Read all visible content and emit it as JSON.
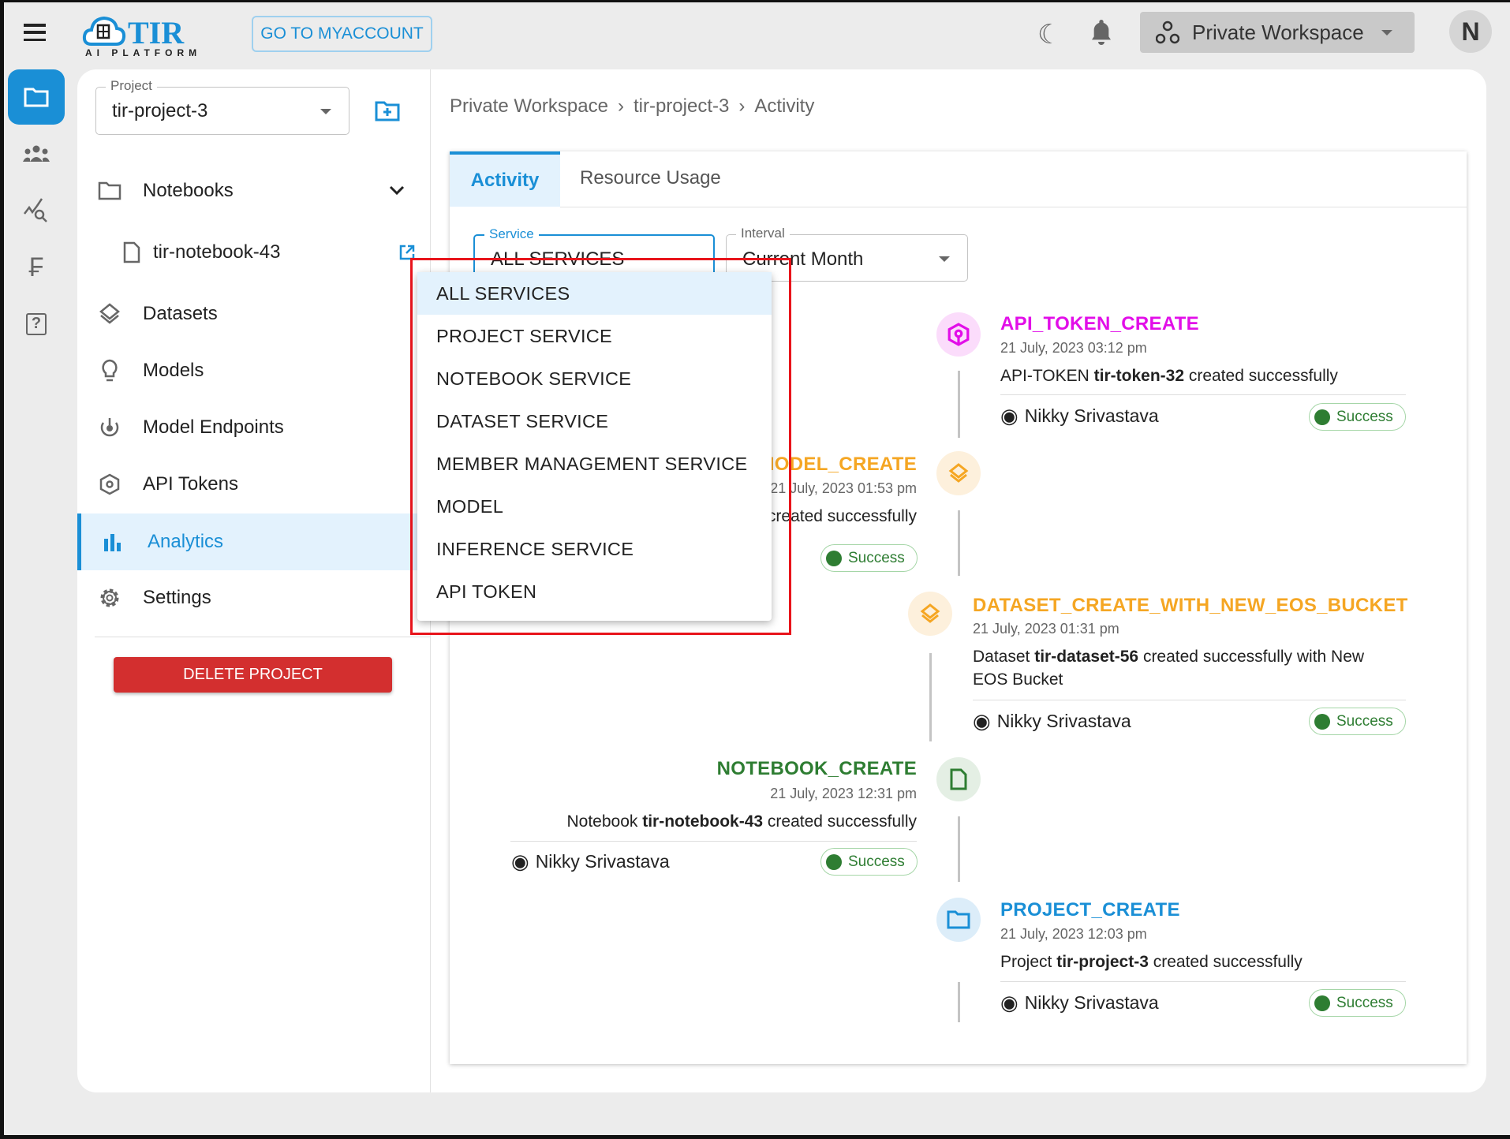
{
  "header": {
    "logo_text": "TIR",
    "logo_sub": "AI PLATFORM",
    "myaccount_label": "GO TO MYACCOUNT",
    "workspace_label": "Private Workspace",
    "avatar_initial": "N"
  },
  "rail": {
    "items": [
      "folder-icon",
      "team-icon",
      "analytics-search-icon",
      "currency-icon",
      "help-icon"
    ]
  },
  "sidebar": {
    "project_label": "Project",
    "project_value": "tir-project-3",
    "items": [
      {
        "label": "Notebooks",
        "icon": "folder-icon"
      },
      {
        "label": "tir-notebook-43",
        "icon": "file-icon"
      },
      {
        "label": "Datasets",
        "icon": "layers-icon"
      },
      {
        "label": "Models",
        "icon": "bulb-icon"
      },
      {
        "label": "Model Endpoints",
        "icon": "endpoint-icon"
      },
      {
        "label": "API Tokens",
        "icon": "cube-icon"
      },
      {
        "label": "Analytics",
        "icon": "bar-chart-icon",
        "active": true
      },
      {
        "label": "Settings",
        "icon": "gear-icon"
      }
    ],
    "delete_label": "DELETE PROJECT"
  },
  "breadcrumb": [
    "Private Workspace",
    "tir-project-3",
    "Activity"
  ],
  "breadcrumb_sep": "›",
  "tabs": [
    {
      "label": "Activity",
      "active": true
    },
    {
      "label": "Resource Usage"
    }
  ],
  "filters": {
    "service_label": "Service",
    "service_value": "ALL SERVICES",
    "interval_label": "Interval",
    "interval_value": "Current Month"
  },
  "service_options": [
    "ALL SERVICES",
    "PROJECT SERVICE",
    "NOTEBOOK SERVICE",
    "DATASET SERVICE",
    "MEMBER MANAGEMENT SERVICE",
    "MODEL",
    "INFERENCE SERVICE",
    "API TOKEN"
  ],
  "activities": [
    {
      "title": "API_TOKEN_CREATE",
      "date": "21 July, 2023 03:12 pm",
      "desc_pre": "API-TOKEN ",
      "desc_bold": "tir-token-32",
      "desc_post": " created successfully",
      "user": "Nikky Srivastava",
      "status": "Success",
      "color": "#e20ee8"
    },
    {
      "title": "MODEL_CREATE",
      "date": "21 July, 2023 01:53 pm",
      "desc_pre": "",
      "desc_bold": "",
      "desc_post": "created successfully",
      "status": "Success",
      "color": "#f5a623"
    },
    {
      "title": "DATASET_CREATE_WITH_NEW_EOS_BUCKET",
      "date": "21 July, 2023 01:31 pm",
      "desc_pre": "Dataset ",
      "desc_bold": "tir-dataset-56",
      "desc_post": " created successfully with New EOS Bucket",
      "user": "Nikky Srivastava",
      "status": "Success",
      "color": "#f5a623"
    },
    {
      "title": "NOTEBOOK_CREATE",
      "date": "21 July, 2023 12:31 pm",
      "desc_pre": "Notebook ",
      "desc_bold": "tir-notebook-43",
      "desc_post": " created successfully",
      "user": "Nikky Srivastava",
      "status": "Success",
      "color": "#2e7d32"
    },
    {
      "title": "PROJECT_CREATE",
      "date": "21 July, 2023 12:03 pm",
      "desc_pre": "Project ",
      "desc_bold": "tir-project-3",
      "desc_post": " created successfully",
      "user": "Nikky Srivastava",
      "status": "Success",
      "color": "#1a8fd6"
    }
  ],
  "colors": {
    "accent": "#1a8fd6",
    "danger": "#d32f2f",
    "success": "#2e7d32",
    "highlight": "#e3f2fd",
    "annotation": "#e8141b"
  }
}
